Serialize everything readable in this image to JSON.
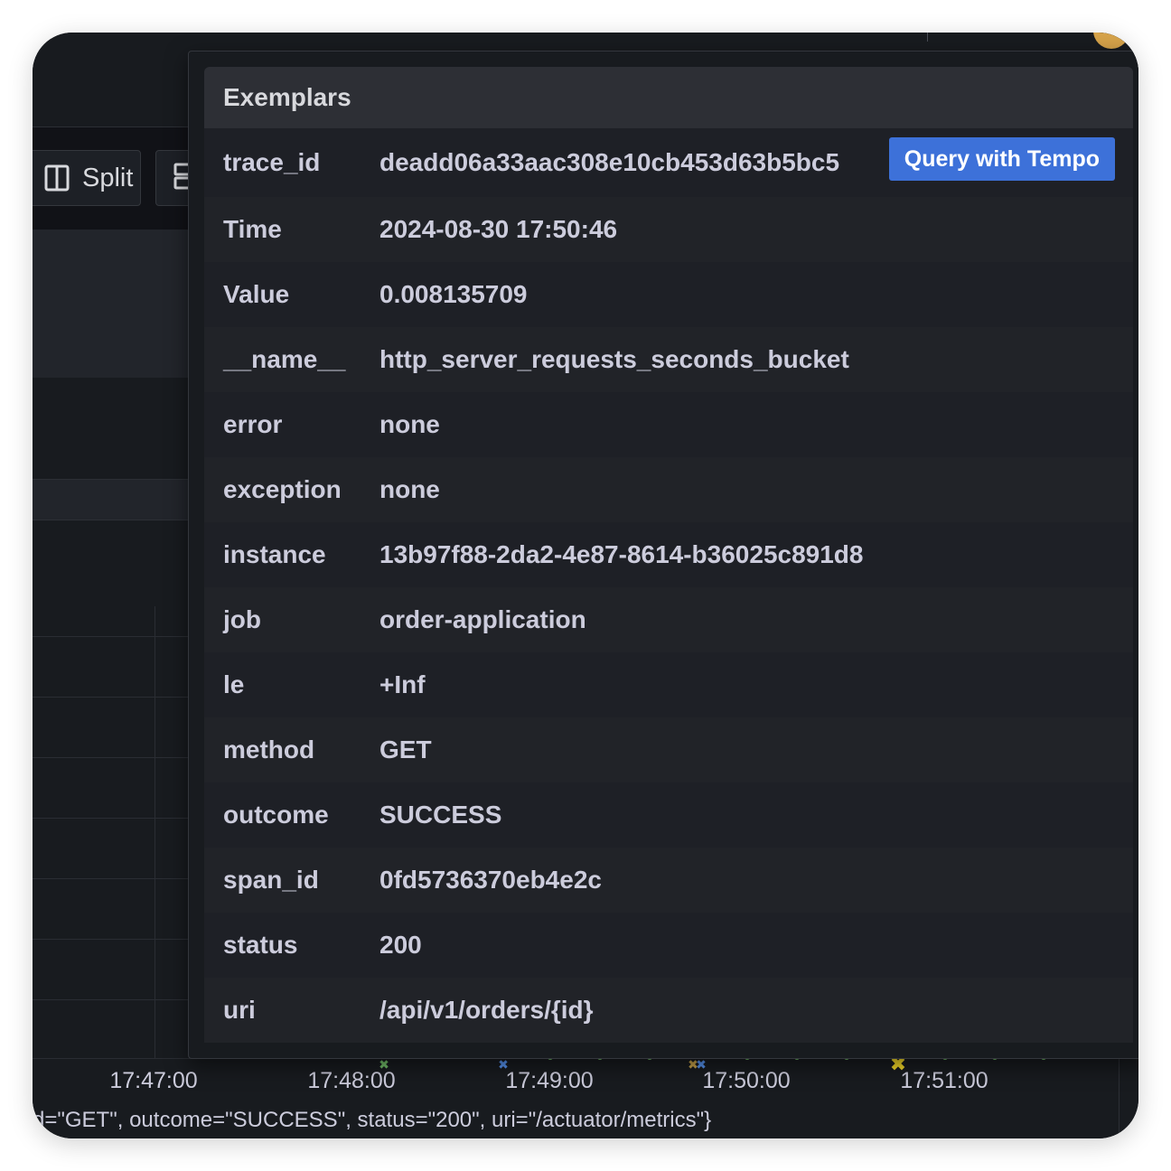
{
  "toolbar": {
    "split_label": "Split"
  },
  "exemplar": {
    "title": "Exemplars",
    "query_button_label": "Query with Tempo",
    "rows": [
      {
        "key": "trace_id",
        "value": "deadd06a33aac308e10cb453d63b5bc5"
      },
      {
        "key": "Time",
        "value": "2024-08-30 17:50:46"
      },
      {
        "key": "Value",
        "value": "0.008135709"
      },
      {
        "key": "__name__",
        "value": "http_server_requests_seconds_bucket"
      },
      {
        "key": "error",
        "value": "none"
      },
      {
        "key": "exception",
        "value": "none"
      },
      {
        "key": "instance",
        "value": "13b97f88-2da2-4e87-8614-b36025c891d8"
      },
      {
        "key": "job",
        "value": "order-application"
      },
      {
        "key": "le",
        "value": "+Inf"
      },
      {
        "key": "method",
        "value": "GET"
      },
      {
        "key": "outcome",
        "value": "SUCCESS"
      },
      {
        "key": "span_id",
        "value": "0fd5736370eb4e2c"
      },
      {
        "key": "status",
        "value": "200"
      },
      {
        "key": "uri",
        "value": "/api/v1/orders/{id}"
      }
    ]
  },
  "graph": {
    "x_ticks": [
      "17:47:00",
      "17:48:00",
      "17:49:00",
      "17:50:00",
      "17:51:00"
    ],
    "legend_text": "d=\"GET\", outcome=\"SUCCESS\", status=\"200\", uri=\"/actuator/metrics\"}"
  },
  "colors": {
    "accent": "#3d71d9",
    "exemplar_green": "#73bf69",
    "exemplar_blue": "#5794f2",
    "exemplar_yellow": "#fade2a"
  },
  "icons": {
    "split": "split-icon",
    "layout": "layout-icon",
    "exemplar_marker": "x-marker-icon"
  }
}
